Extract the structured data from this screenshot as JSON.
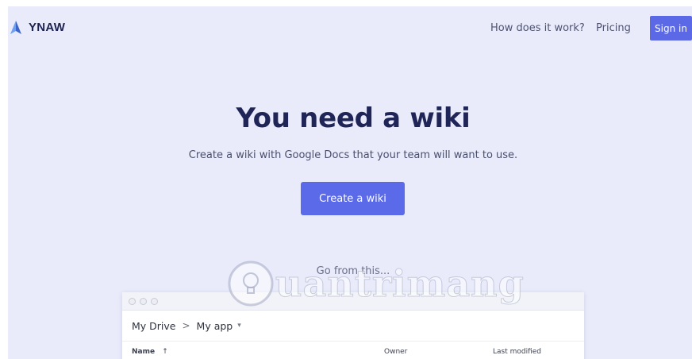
{
  "brand": {
    "name": "YNAW",
    "logo_color": "#4a7fe0"
  },
  "nav": {
    "how_it_works": "How does it work?",
    "pricing": "Pricing",
    "sign_in": "Sign in"
  },
  "hero": {
    "title": "You need a wiki",
    "subtitle": "Create a wiki with Google Docs that your team will want to use.",
    "cta": "Create a wiki",
    "go_from": "Go from this..."
  },
  "drive_window": {
    "breadcrumb": [
      "My Drive",
      "My app"
    ],
    "breadcrumb_separator": ">",
    "columns": {
      "name": "Name",
      "name_sort": "↑",
      "owner": "Owner",
      "last_modified": "Last modified"
    }
  },
  "watermark": {
    "text": "uantrimang"
  },
  "colors": {
    "accent": "#5b69e6",
    "background": "#e9ebfb",
    "title": "#1f2557"
  }
}
